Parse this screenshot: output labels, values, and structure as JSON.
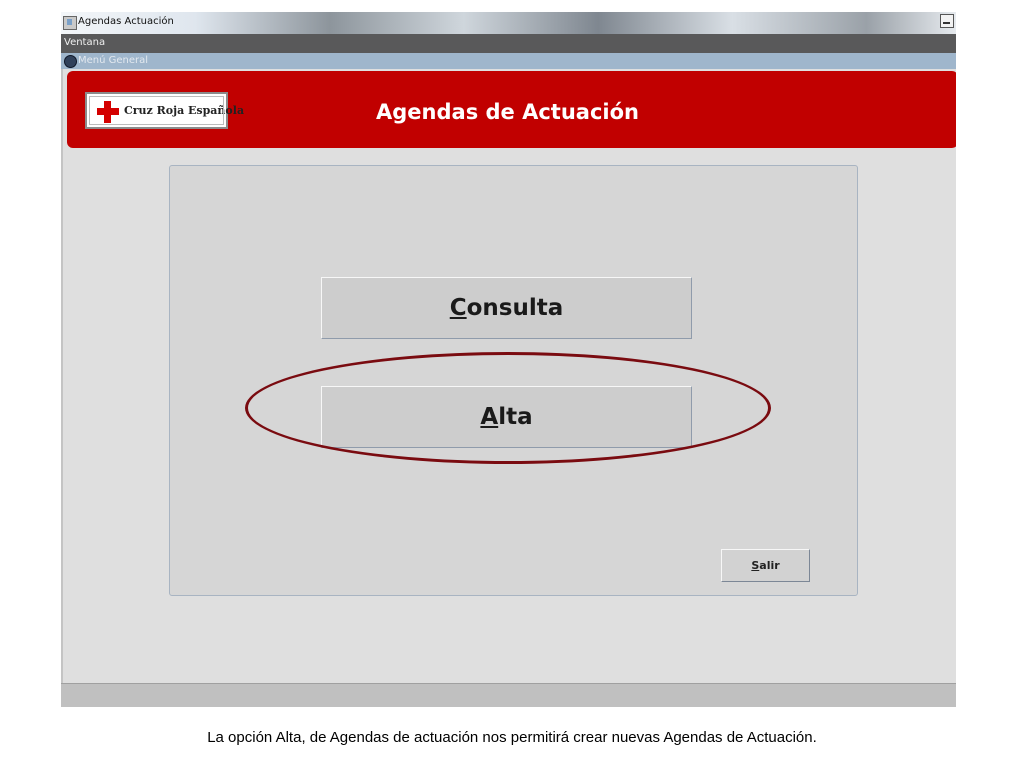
{
  "window": {
    "title": "Agendas Actuación"
  },
  "menubar": {
    "items": [
      {
        "label": "Ventana"
      }
    ]
  },
  "internal_frame": {
    "title": "Menú General"
  },
  "header": {
    "logo_text": "Cruz Roja Española",
    "title": "Agendas de Actuación"
  },
  "buttons": {
    "consulta": "Consulta",
    "alta": "Alta",
    "salir": "Salir"
  },
  "annotation": {
    "highlighted_option": "Alta",
    "color": "#7a0b10"
  },
  "caption": "La opción Alta, de Agendas de actuación nos permitirá crear nuevas Agendas de Actuación.",
  "colors": {
    "banner": "#c10000",
    "menubar": "#59595a",
    "panel": "#d6d6d6"
  }
}
